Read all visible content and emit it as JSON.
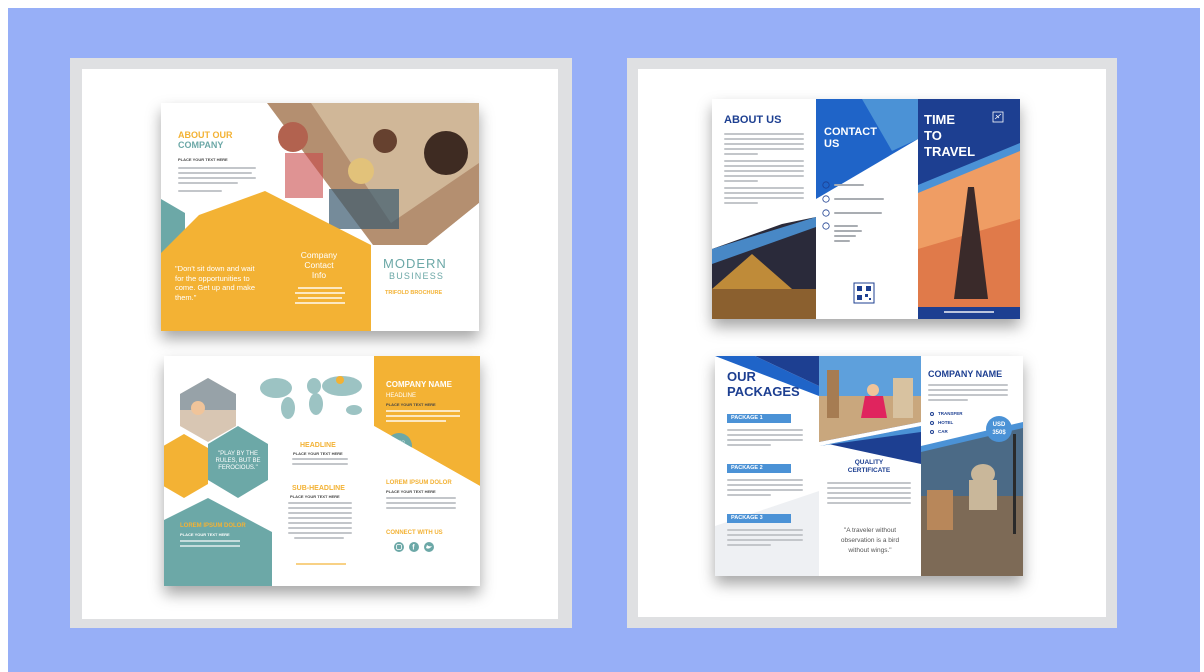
{
  "palette": {
    "background": "#97aff7",
    "frame": "#dfe0e2",
    "yellow": "#f3b234",
    "teal": "#6ca8a7",
    "navy": "#1d3f91",
    "blue": "#1f64c8",
    "lightblue": "#4b92d6"
  },
  "brochure_modern_front": {
    "about_title_line1": "ABOUT OUR",
    "about_title_line2": "COMPANY",
    "place_text": "PLACE YOUR TEXT HERE",
    "quote": "\"Don't sit down and wait for the opportunities to come. Get up and make them.\"",
    "contact_line1": "Company",
    "contact_line2": "Contact",
    "contact_line3": "Info",
    "brand_line1": "MODERN",
    "brand_line2": "BUSINESS",
    "brand_line3": "TRIFOLD BROCHURE"
  },
  "brochure_modern_back": {
    "quote": "\"PLAY BY THE RULES, BUT BE FEROCIOUS.\"",
    "headline": "HEADLINE",
    "place_text": "PLACE YOUR TEXT HERE",
    "sub_headline": "SUB-HEADLINE",
    "lorem_title": "LOREM IPSUM DOLOR",
    "company_name": "COMPANY NAME",
    "company_headline": "HEADLINE",
    "logo_label": "LOGO HERE",
    "lorem_title_right": "LOREM IPSUM DOLOR",
    "connect": "CONNECT WITH US",
    "social_icons": [
      "instagram-icon",
      "facebook-icon",
      "twitter-icon"
    ]
  },
  "brochure_travel_front": {
    "about_title": "ABOUT US",
    "contact_line1": "CONTACT",
    "contact_line2": "US",
    "travel_line1": "TIME",
    "travel_line2": "TO",
    "travel_line3": "TRAVEL",
    "contact_icons": [
      "phone-icon",
      "email-icon",
      "globe-icon",
      "location-pin-icon"
    ]
  },
  "brochure_travel_back": {
    "packages_line1": "OUR",
    "packages_line2": "PACKAGES",
    "packages": [
      "PACKAGE 1",
      "PACKAGE 2",
      "PACKAGE 3"
    ],
    "cert_line1": "QUALITY",
    "cert_line2": "CERTIFICATE",
    "quote": "\"A traveler without observation is a bird without wings.\"",
    "company_name": "COMPANY NAME",
    "services": [
      "TRANSFER",
      "HOTEL",
      "CAR"
    ],
    "price_line1": "USD",
    "price_line2": "350$"
  }
}
